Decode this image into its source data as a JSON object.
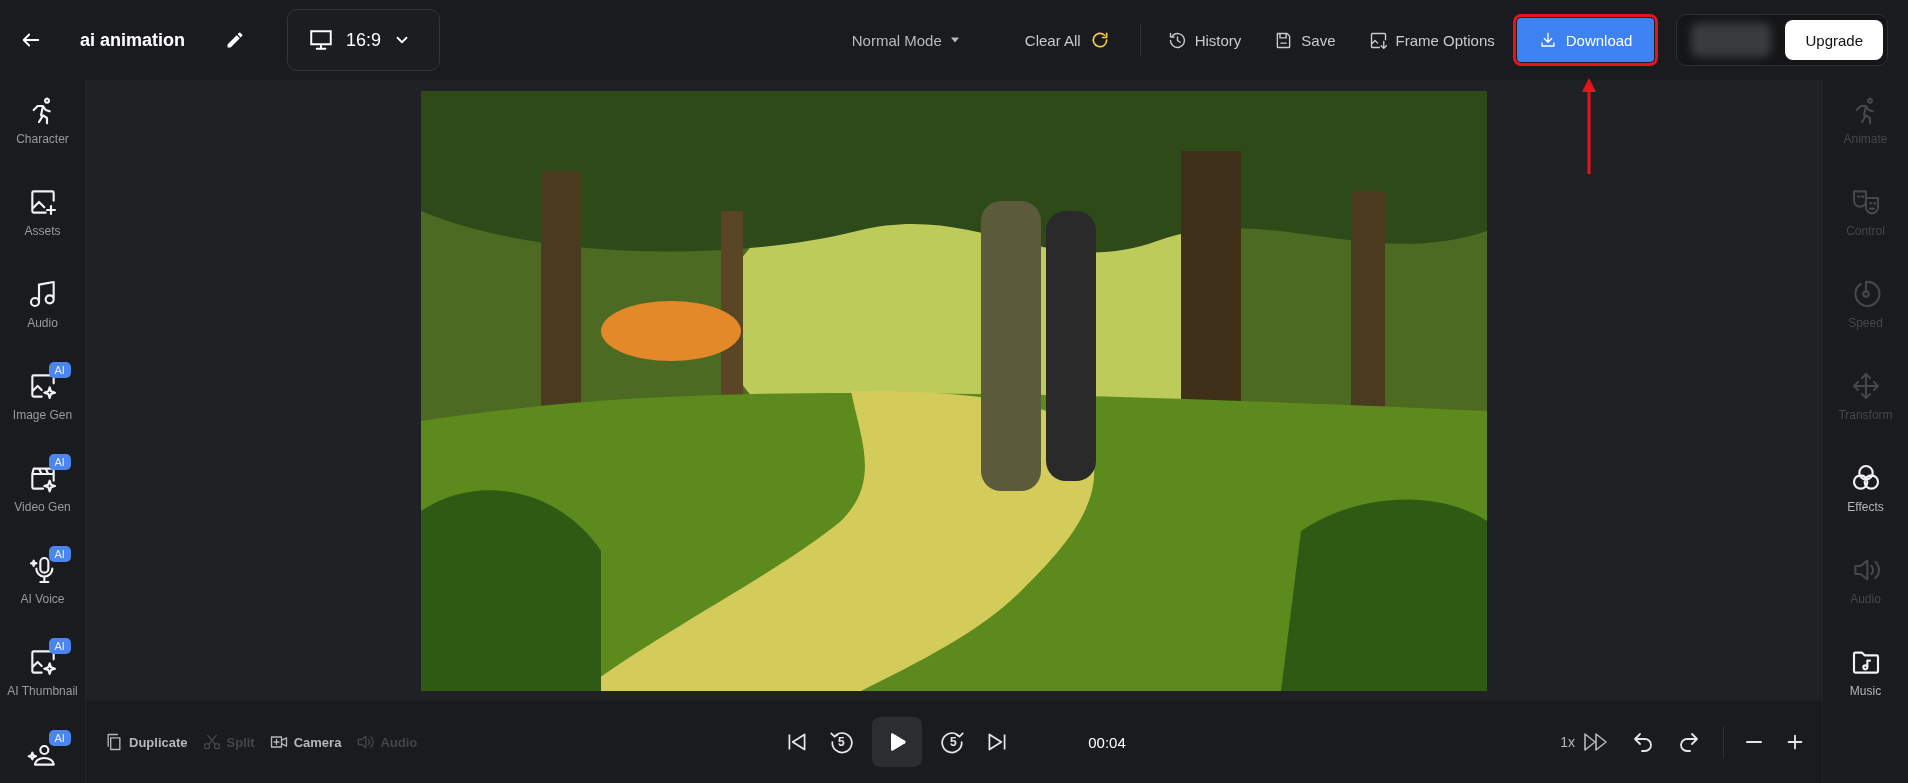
{
  "header": {
    "title": "ai animation",
    "aspect_ratio": "16:9",
    "mode": "Normal Mode",
    "clear_label": "Clear All",
    "actions": [
      {
        "label": "History"
      },
      {
        "label": "Save"
      },
      {
        "label": "Frame Options"
      }
    ],
    "download": {
      "label": "Download",
      "annotated": true
    },
    "upgrade": "Upgrade"
  },
  "left_tools": [
    {
      "label": "Character"
    },
    {
      "label": "Assets"
    },
    {
      "label": "Audio"
    },
    {
      "label": "Image Gen",
      "badge": "AI"
    },
    {
      "label": "Video Gen",
      "badge": "AI"
    },
    {
      "label": "AI Voice",
      "badge": "AI"
    },
    {
      "label": "AI Thumbnail",
      "badge": "AI"
    },
    {
      "badge": "AI"
    }
  ],
  "right_tools": [
    {
      "label": "Animate",
      "disabled": true
    },
    {
      "label": "Control",
      "disabled": true
    },
    {
      "label": "Speed",
      "disabled": true
    },
    {
      "label": "Transform",
      "disabled": true
    },
    {
      "label": "Effects",
      "disabled": false
    },
    {
      "label": "Audio",
      "disabled": true
    },
    {
      "label": "Music",
      "disabled": false
    }
  ],
  "bottom": {
    "tools": [
      {
        "label": "Duplicate",
        "disabled": false
      },
      {
        "label": "Split",
        "disabled": true
      },
      {
        "label": "Camera",
        "disabled": false
      },
      {
        "label": "Audio",
        "disabled": true
      }
    ],
    "skip_back": "5",
    "skip_forward": "5",
    "time": "00:04",
    "speed": "1x"
  }
}
